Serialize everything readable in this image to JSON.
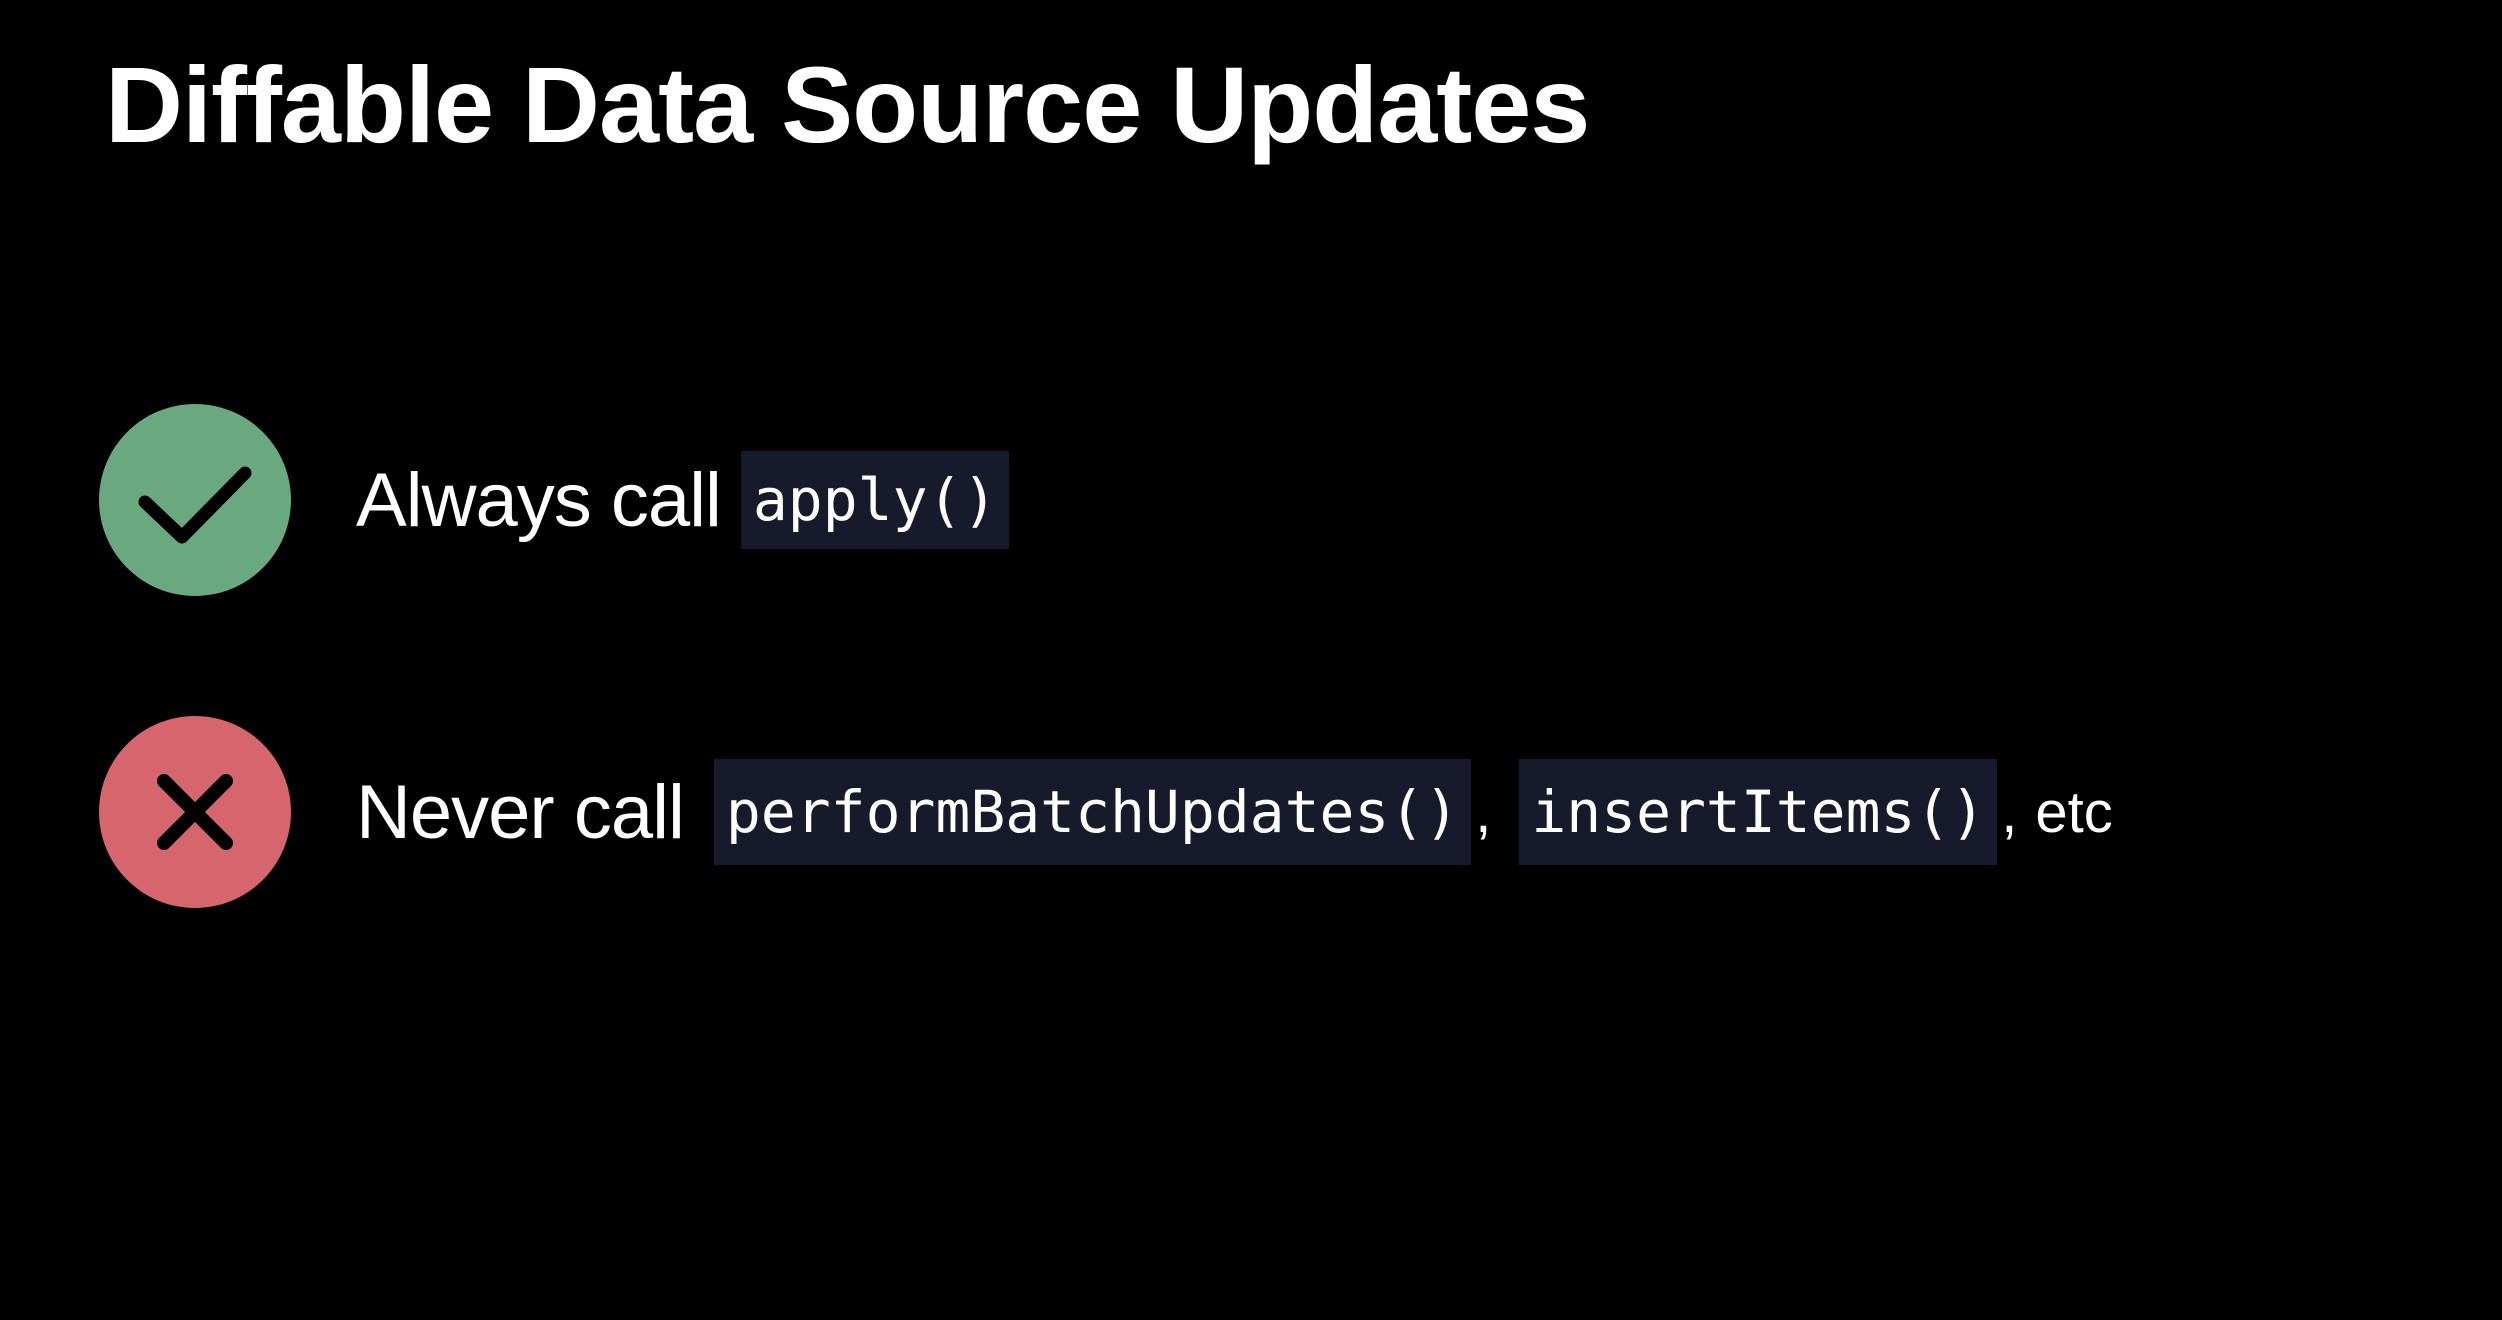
{
  "title": "Diffable Data Source Updates",
  "rules": [
    {
      "kind": "do",
      "icon": "checkmark-icon",
      "badge_color": "#6aa87f",
      "text": "Always call",
      "code": [
        "apply()"
      ]
    },
    {
      "kind": "dont",
      "icon": "xmark-icon",
      "badge_color": "#d6656e",
      "text": "Never call",
      "code": [
        "performBatchUpdates()",
        "insertItems()"
      ],
      "separator": ",",
      "trailing": "etc"
    }
  ],
  "colors": {
    "background": "#000000",
    "text": "#ffffff",
    "code_background": "#171a2b"
  }
}
